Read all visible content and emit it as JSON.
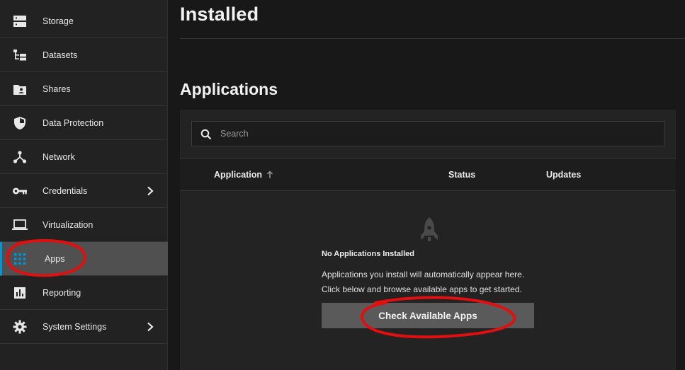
{
  "sidebar": {
    "items": [
      {
        "label": "Storage",
        "icon": "storage-icon"
      },
      {
        "label": "Datasets",
        "icon": "datasets-icon"
      },
      {
        "label": "Shares",
        "icon": "shares-icon"
      },
      {
        "label": "Data Protection",
        "icon": "shield-icon"
      },
      {
        "label": "Network",
        "icon": "network-icon"
      },
      {
        "label": "Credentials",
        "icon": "key-icon",
        "has_submenu": true
      },
      {
        "label": "Virtualization",
        "icon": "laptop-icon"
      },
      {
        "label": "Apps",
        "icon": "apps-grid-icon",
        "active": true
      },
      {
        "label": "Reporting",
        "icon": "reporting-icon"
      },
      {
        "label": "System Settings",
        "icon": "gear-icon",
        "has_submenu": true
      }
    ]
  },
  "main": {
    "title": "Installed",
    "section_title": "Applications",
    "search": {
      "placeholder": "Search",
      "value": ""
    },
    "table": {
      "columns": [
        "Application",
        "Status",
        "Updates"
      ]
    },
    "empty_state": {
      "title": "No Applications Installed",
      "line1": "Applications you install will automatically appear here.",
      "line2": "Click below and browse available apps to get started.",
      "button_label": "Check Available Apps"
    }
  },
  "colors": {
    "accent": "#0095d5",
    "annotation": "#e01010"
  }
}
